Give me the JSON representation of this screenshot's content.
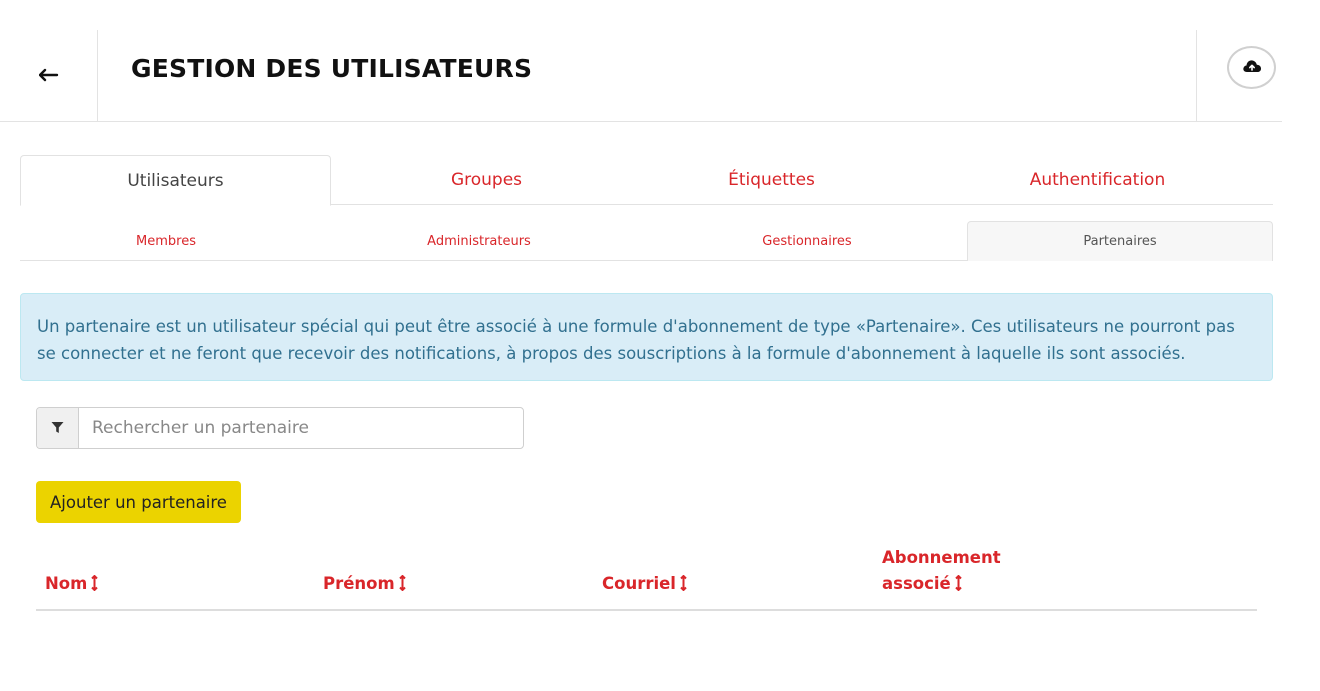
{
  "header": {
    "title": "GESTION DES UTILISATEURS",
    "back_icon": "arrow-left-icon",
    "action_icon": "cloud-upload-icon"
  },
  "tabs": [
    {
      "label": "Utilisateurs",
      "active": true
    },
    {
      "label": "Groupes",
      "active": false
    },
    {
      "label": "Étiquettes",
      "active": false
    },
    {
      "label": "Authentification",
      "active": false
    }
  ],
  "subtabs": [
    {
      "label": "Membres",
      "active": false
    },
    {
      "label": "Administrateurs",
      "active": false
    },
    {
      "label": "Gestionnaires",
      "active": false
    },
    {
      "label": "Partenaires",
      "active": true
    }
  ],
  "info": {
    "text": "Un partenaire est un utilisateur spécial qui peut être associé à une formule d'abonnement de type «Partenaire». Ces utilisateurs ne pourront pas se connecter et ne feront que recevoir des notifications, à propos des souscriptions à la formule d'abonnement à laquelle ils sont associés."
  },
  "search": {
    "placeholder": "Rechercher un partenaire",
    "value": "",
    "icon": "filter-icon"
  },
  "add_button": {
    "label": "Ajouter un partenaire"
  },
  "table": {
    "columns": [
      {
        "label": "Nom"
      },
      {
        "label": "Prénom"
      },
      {
        "label": "Courriel"
      },
      {
        "label": "Abonnement associé"
      }
    ],
    "rows": []
  },
  "colors": {
    "accent": "#d9262a",
    "primary_button": "#ebd300",
    "info_bg": "#d9edf7",
    "info_text": "#31708f"
  }
}
